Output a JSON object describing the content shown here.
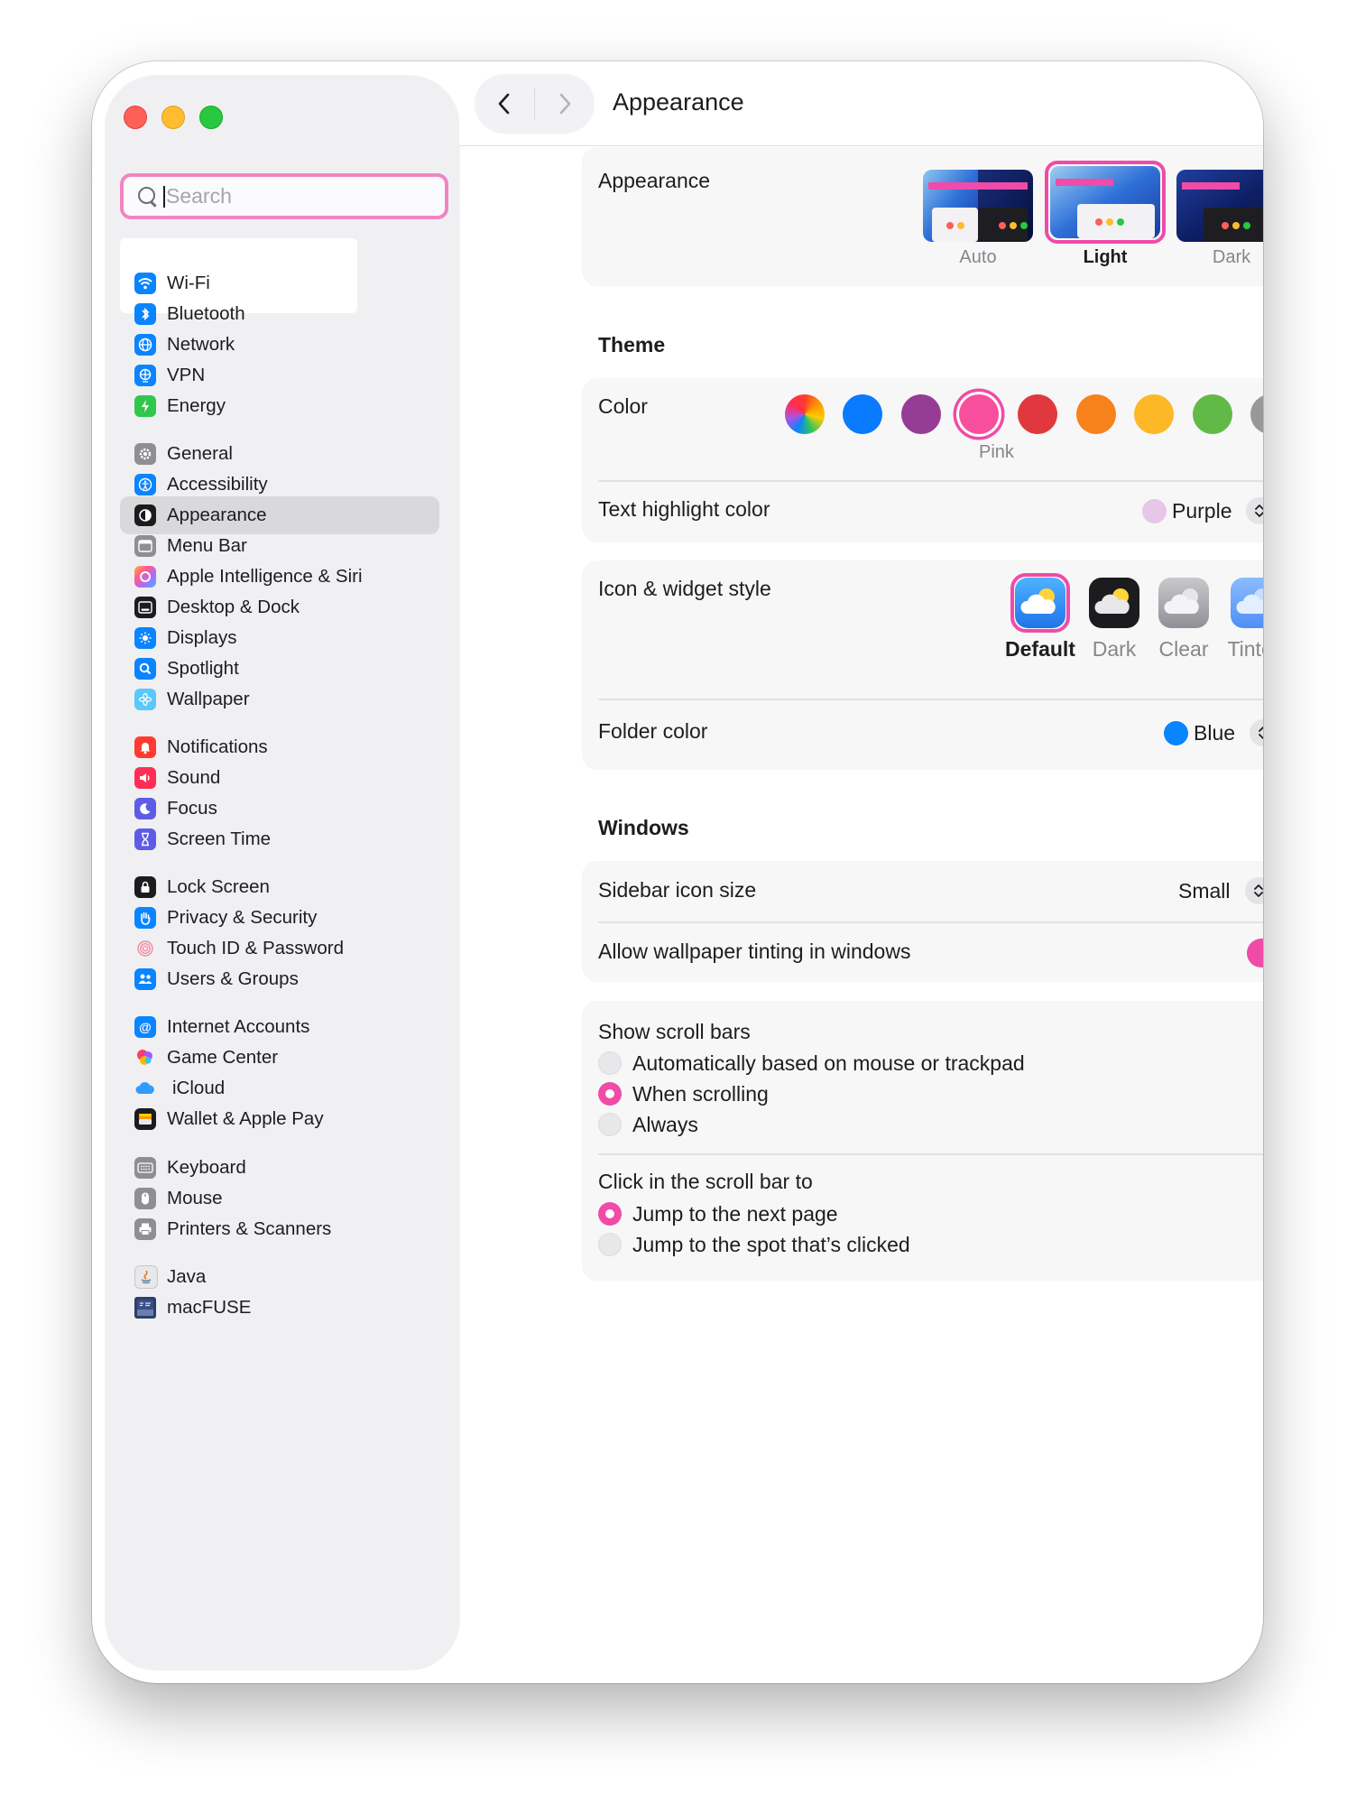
{
  "search": {
    "placeholder": "Search"
  },
  "sidebar": {
    "groups": [
      [
        {
          "label": "Wi-Fi",
          "icon": "wifi-icon",
          "color": "#0a84ff"
        },
        {
          "label": "Bluetooth",
          "icon": "bluetooth-icon",
          "color": "#0a84ff"
        },
        {
          "label": "Network",
          "icon": "globe-icon",
          "color": "#0a84ff"
        },
        {
          "label": "VPN",
          "icon": "vpn-globe-icon",
          "color": "#0a84ff"
        },
        {
          "label": "Energy",
          "icon": "energy-bolt-icon",
          "color": "#30c74b"
        }
      ],
      [
        {
          "label": "General",
          "icon": "gear-icon",
          "color": "#8e8e93"
        },
        {
          "label": "Accessibility",
          "icon": "accessibility-icon",
          "color": "#0a84ff"
        },
        {
          "label": "Appearance",
          "icon": "appearance-icon",
          "color": "#1c1c1e",
          "selected": true
        },
        {
          "label": "Menu Bar",
          "icon": "menu-bar-icon",
          "color": "#8e8e93"
        },
        {
          "label": "Apple Intelligence & Siri",
          "icon": "siri-icon",
          "color": "#f7768e"
        },
        {
          "label": "Desktop & Dock",
          "icon": "dock-icon",
          "color": "#1c1c1e"
        },
        {
          "label": "Displays",
          "icon": "sun-icon",
          "color": "#0a84ff"
        },
        {
          "label": "Spotlight",
          "icon": "magnifier-icon",
          "color": "#0a84ff"
        },
        {
          "label": "Wallpaper",
          "icon": "flower-icon",
          "color": "#5ac8fa"
        }
      ],
      [
        {
          "label": "Notifications",
          "icon": "bell-icon",
          "color": "#ff3b30"
        },
        {
          "label": "Sound",
          "icon": "speaker-icon",
          "color": "#ff2d55"
        },
        {
          "label": "Focus",
          "icon": "moon-icon",
          "color": "#5e5ce6"
        },
        {
          "label": "Screen Time",
          "icon": "hourglass-icon",
          "color": "#5e5ce6"
        }
      ],
      [
        {
          "label": "Lock Screen",
          "icon": "lock-icon",
          "color": "#1c1c1e"
        },
        {
          "label": "Privacy & Security",
          "icon": "hand-icon",
          "color": "#0a84ff"
        },
        {
          "label": "Touch ID & Password",
          "icon": "fingerprint-icon",
          "color": "#f8a6b8",
          "bare": true
        },
        {
          "label": "Users & Groups",
          "icon": "users-icon",
          "color": "#0a84ff"
        }
      ],
      [
        {
          "label": "Internet Accounts",
          "icon": "at-sign-icon",
          "color": "#0a84ff"
        },
        {
          "label": "Game Center",
          "icon": "game-center-icon",
          "color": "#ff2d55",
          "bare": true
        },
        {
          "label": "iCloud",
          "icon": "cloud-icon",
          "color": "#0a84ff",
          "bare": true
        },
        {
          "label": "Wallet & Apple Pay",
          "icon": "wallet-icon",
          "color": "#1c1c1e"
        }
      ],
      [
        {
          "label": "Keyboard",
          "icon": "keyboard-icon",
          "color": "#8e8e93"
        },
        {
          "label": "Mouse",
          "icon": "mouse-icon",
          "color": "#8e8e93"
        },
        {
          "label": "Printers & Scanners",
          "icon": "printer-icon",
          "color": "#8e8e93"
        }
      ],
      [
        {
          "label": "Java",
          "icon": "java-icon",
          "color": "#e8e8ea"
        },
        {
          "label": "macFUSE",
          "icon": "macfuse-icon",
          "color": "#2c3e6b"
        }
      ]
    ]
  },
  "header": {
    "title": "Appearance"
  },
  "appearance": {
    "label": "Appearance",
    "options": [
      {
        "label": "Auto",
        "selected": false
      },
      {
        "label": "Light",
        "selected": true
      },
      {
        "label": "Dark",
        "selected": false
      }
    ]
  },
  "theme": {
    "title": "Theme",
    "color_label": "Color",
    "colors": [
      {
        "name": "multicolor",
        "value": "conic-gradient(#ff3b30, #ff9500, #ffcc00, #34c759, #0a84ff, #af52de, #ff2d55, #ff3b30)"
      },
      {
        "name": "blue",
        "value": "#0a7aff"
      },
      {
        "name": "purple",
        "value": "#953d96"
      },
      {
        "name": "pink",
        "value": "#f74f9e",
        "selected": true,
        "label": "Pink"
      },
      {
        "name": "red",
        "value": "#e0383e"
      },
      {
        "name": "orange",
        "value": "#f7821b"
      },
      {
        "name": "yellow",
        "value": "#fcb827"
      },
      {
        "name": "green",
        "value": "#62ba46"
      },
      {
        "name": "graphite",
        "value": "#989898"
      }
    ],
    "highlight_label": "Text highlight color",
    "highlight_value": "Purple",
    "highlight_color": "#e6c6e9"
  },
  "icon_widget": {
    "label": "Icon & widget style",
    "options": [
      {
        "label": "Default",
        "selected": true
      },
      {
        "label": "Dark",
        "selected": false
      },
      {
        "label": "Clear",
        "selected": false
      },
      {
        "label": "Tinted",
        "selected": false
      }
    ],
    "folder_label": "Folder color",
    "folder_value": "Blue",
    "folder_color": "#0a84ff"
  },
  "windows": {
    "title": "Windows",
    "sidebar_icon_label": "Sidebar icon size",
    "sidebar_icon_value": "Small",
    "tinting_label": "Allow wallpaper tinting in windows",
    "tinting_on": true
  },
  "scroll": {
    "show_title": "Show scroll bars",
    "show_options": [
      {
        "label": "Automatically based on mouse or trackpad",
        "selected": false
      },
      {
        "label": "When scrolling",
        "selected": true
      },
      {
        "label": "Always",
        "selected": false
      }
    ],
    "click_title": "Click in the scroll bar to",
    "click_options": [
      {
        "label": "Jump to the next page",
        "selected": true
      },
      {
        "label": "Jump to the spot that’s clicked",
        "selected": false
      }
    ]
  },
  "help": {
    "label": "?"
  },
  "colors": {
    "accent": "#f04ba8"
  }
}
